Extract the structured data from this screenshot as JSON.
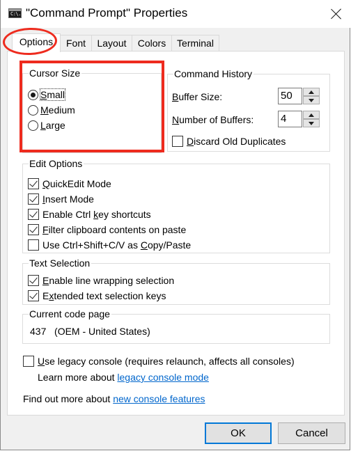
{
  "window": {
    "title": "\"Command Prompt\" Properties",
    "app_icon_text": "C:\\."
  },
  "tabs": [
    {
      "label": "Options",
      "active": true
    },
    {
      "label": "Font",
      "active": false
    },
    {
      "label": "Layout",
      "active": false
    },
    {
      "label": "Colors",
      "active": false
    },
    {
      "label": "Terminal",
      "active": false
    }
  ],
  "cursor_size": {
    "legend": "Cursor Size",
    "options": [
      {
        "label_ul": "S",
        "label_rest": "mall",
        "selected": true
      },
      {
        "label_ul": "M",
        "label_rest": "edium",
        "selected": false
      },
      {
        "label_ul": "L",
        "label_rest": "arge",
        "selected": false
      }
    ]
  },
  "command_history": {
    "legend": "Command History",
    "buffer_size": {
      "label_ul": "B",
      "label_rest": "uffer Size:",
      "value": "50"
    },
    "number_of_buffers": {
      "label_ul": "N",
      "label_rest": "umber of Buffers:",
      "value": "4"
    },
    "discard_duplicates": {
      "label_ul": "D",
      "label_rest": "iscard Old Duplicates",
      "checked": false
    }
  },
  "edit_options": {
    "legend": "Edit Options",
    "items": [
      {
        "pre": "",
        "ul": "Q",
        "post": "uickEdit Mode",
        "checked": true
      },
      {
        "pre": "",
        "ul": "I",
        "post": "nsert Mode",
        "checked": true
      },
      {
        "pre": "Enable Ctrl ",
        "ul": "k",
        "post": "ey shortcuts",
        "checked": true
      },
      {
        "pre": "",
        "ul": "F",
        "post": "ilter clipboard contents on paste",
        "checked": true
      },
      {
        "pre": "Use Ctrl+Shift+C/V as ",
        "ul": "C",
        "post": "opy/Paste",
        "checked": false
      }
    ]
  },
  "text_selection": {
    "legend": "Text Selection",
    "items": [
      {
        "pre": "",
        "ul": "E",
        "post": "nable line wrapping selection",
        "checked": true
      },
      {
        "pre": "E",
        "ul": "x",
        "post": "tended text selection keys",
        "checked": true
      }
    ]
  },
  "code_page": {
    "legend": "Current code page",
    "value": "437   (OEM - United States)"
  },
  "legacy": {
    "checkbox_ul": "U",
    "checkbox_rest": "se legacy console (requires relaunch, affects all consoles)",
    "checked": false,
    "learn_more_text": "Learn more about ",
    "learn_more_link": "legacy console mode"
  },
  "find_out": {
    "text": "Find out more about ",
    "link": "new console features"
  },
  "buttons": {
    "ok": "OK",
    "cancel": "Cancel"
  },
  "annotations": {
    "highlight_color": "#ee2b1e"
  }
}
